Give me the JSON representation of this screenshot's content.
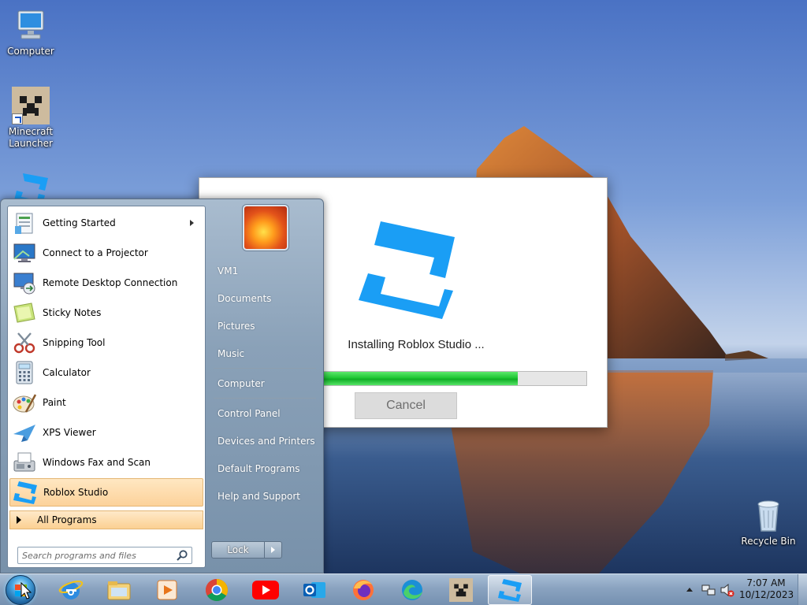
{
  "desktop": {
    "icons": [
      {
        "label": "Computer",
        "icon": "computer-icon"
      },
      {
        "label": "Minecraft Launcher",
        "icon": "minecraft-icon"
      },
      {
        "label": "Recycle Bin",
        "icon": "recycle-bin-icon"
      }
    ]
  },
  "installer": {
    "status": "Installing Roblox Studio ...",
    "progress": 0.81,
    "cancel_label": "Cancel",
    "icon": "roblox-studio-icon"
  },
  "start_menu": {
    "programs": [
      {
        "label": "Getting Started",
        "icon": "getting-started-icon",
        "submenu": true
      },
      {
        "label": "Connect to a Projector",
        "icon": "projector-icon"
      },
      {
        "label": "Remote Desktop Connection",
        "icon": "remote-desktop-icon"
      },
      {
        "label": "Sticky Notes",
        "icon": "sticky-notes-icon"
      },
      {
        "label": "Snipping Tool",
        "icon": "snipping-tool-icon"
      },
      {
        "label": "Calculator",
        "icon": "calculator-icon"
      },
      {
        "label": "Paint",
        "icon": "paint-icon"
      },
      {
        "label": "XPS Viewer",
        "icon": "xps-viewer-icon"
      },
      {
        "label": "Windows Fax and Scan",
        "icon": "fax-scan-icon"
      },
      {
        "label": "Roblox Studio",
        "icon": "roblox-studio-icon",
        "selected": true
      }
    ],
    "all_programs_label": "All Programs",
    "search_placeholder": "Search programs and files",
    "right_links": [
      "VM1",
      "Documents",
      "Pictures",
      "Music",
      "Computer",
      "Control Panel",
      "Devices and Printers",
      "Default Programs",
      "Help and Support"
    ],
    "lock_label": "Lock"
  },
  "taskbar": {
    "pinned": [
      "internet-explorer-icon",
      "file-explorer-icon",
      "media-player-icon",
      "chrome-icon",
      "youtube-icon",
      "outlook-icon",
      "firefox-icon",
      "edge-icon",
      "minecraft-icon",
      "roblox-studio-icon"
    ],
    "clock_time": "7:07 AM",
    "clock_date": "10/12/2023"
  },
  "colors": {
    "progress_green": "#1fc734",
    "roblox_blue": "#1a9ef5",
    "selection_orange": "#fcd29a"
  }
}
